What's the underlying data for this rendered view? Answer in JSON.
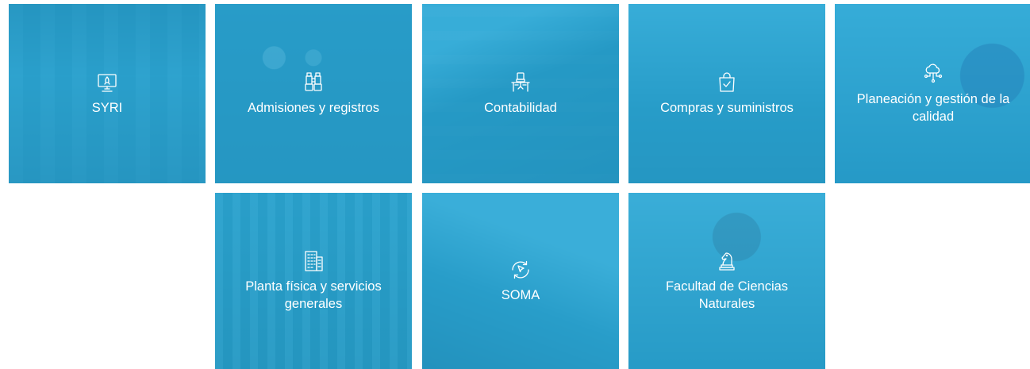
{
  "tiles": [
    {
      "id": "syri",
      "label": "SYRI",
      "icon": "monitor-rocket-icon"
    },
    {
      "id": "admisiones",
      "label": "Admisiones y registros",
      "icon": "binoculars-icon"
    },
    {
      "id": "contabilidad",
      "label": "Contabilidad",
      "icon": "office-chair-desk-icon"
    },
    {
      "id": "compras",
      "label": "Compras y suministros",
      "icon": "shopping-bag-check-icon"
    },
    {
      "id": "planeacion",
      "label": "Planeación y gestión de la calidad",
      "icon": "cloud-network-icon"
    },
    {
      "id": "planta",
      "label": "Planta física y servicios generales",
      "icon": "building-icon"
    },
    {
      "id": "soma",
      "label": "SOMA",
      "icon": "cursor-refresh-icon"
    },
    {
      "id": "facultad",
      "label": "Facultad de Ciencias Naturales",
      "icon": "chess-knight-icon"
    }
  ],
  "colors": {
    "tile_overlay": "#28a8d6",
    "text": "#ffffff",
    "page_background": "#ffffff"
  }
}
